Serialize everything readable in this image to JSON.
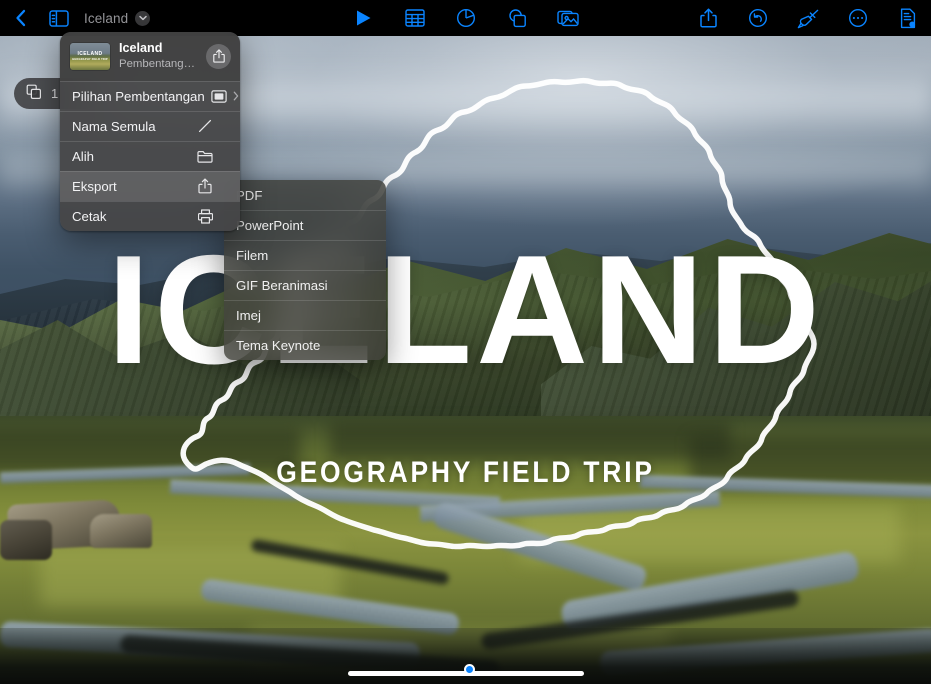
{
  "toolbar": {
    "back_label": "back-navigation",
    "sidebar_toggle_label": "sidebar-toggle",
    "document_title": "Iceland",
    "center_tools": [
      {
        "name": "play-icon",
        "label": "Play"
      },
      {
        "name": "table-icon",
        "label": "Table"
      },
      {
        "name": "chart-icon",
        "label": "Chart"
      },
      {
        "name": "shape-icon",
        "label": "Shape"
      },
      {
        "name": "media-icon",
        "label": "Media"
      }
    ],
    "right_tools": [
      {
        "name": "share-icon",
        "label": "Share"
      },
      {
        "name": "undo-icon",
        "label": "Undo"
      },
      {
        "name": "format-brush-icon",
        "label": "Format"
      },
      {
        "name": "more-icon",
        "label": "More"
      },
      {
        "name": "document-options-icon",
        "label": "Document Options"
      }
    ]
  },
  "slide_pill": {
    "icon": "slides-icon",
    "count": "1"
  },
  "slide": {
    "title": "ICELAND",
    "subtitle": "GEOGRAPHY FIELD TRIP"
  },
  "context_menu": {
    "header": {
      "name": "Iceland",
      "subtitle": "Pembentangan Keyn…",
      "thumb_title": "ICELAND",
      "thumb_subtitle": "GEOGRAPHY FIELD TRIP",
      "share_icon": "share-icon"
    },
    "items": [
      {
        "label": "Pilihan Pembentangan",
        "icon": "presentation-icon",
        "chevron": "›",
        "selected": false
      },
      {
        "label": "Nama Semula",
        "icon": "pencil-icon",
        "chevron": "",
        "selected": false
      },
      {
        "label": "Alih",
        "icon": "folder-icon",
        "chevron": "",
        "selected": false
      },
      {
        "label": "Eksport",
        "icon": "share-icon",
        "chevron": "",
        "selected": true
      },
      {
        "label": "Cetak",
        "icon": "printer-icon",
        "chevron": "",
        "selected": false
      }
    ]
  },
  "export_submenu": {
    "items": [
      {
        "label": "PDF"
      },
      {
        "label": "PowerPoint"
      },
      {
        "label": "Filem"
      },
      {
        "label": "GIF Beranimasi"
      },
      {
        "label": "Imej"
      },
      {
        "label": "Tema Keynote"
      }
    ]
  },
  "colors": {
    "accent": "#0a84ff",
    "toolbar_bg": "#000000",
    "menu_bg": "#454546",
    "submenu_bg": "#3e3e38",
    "menu_text": "#f2f2f4",
    "title_text": "#ffffff"
  }
}
